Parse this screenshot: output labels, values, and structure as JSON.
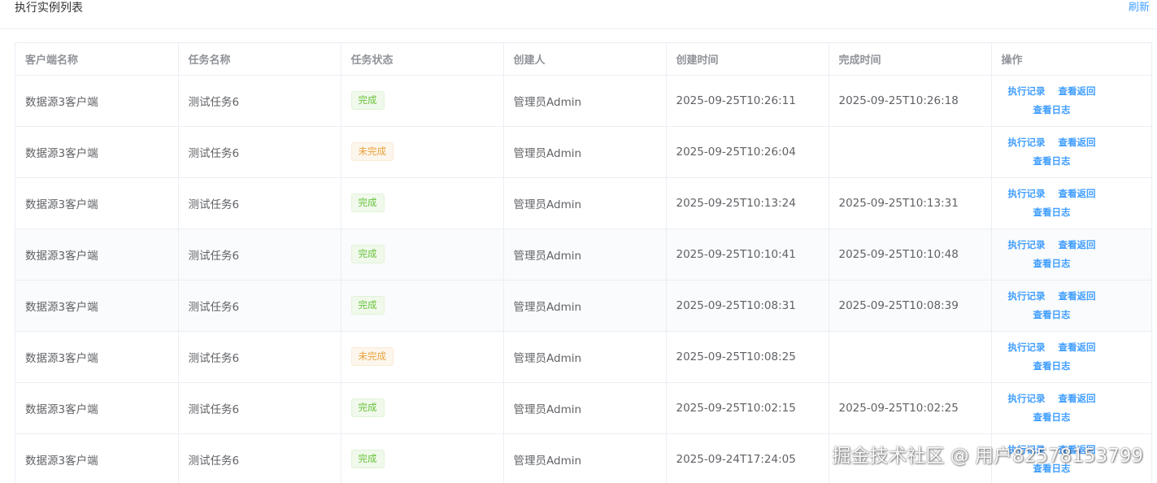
{
  "header": {
    "title": "执行实例列表",
    "refresh_label": "刷新"
  },
  "table": {
    "columns": [
      "客户端名称",
      "任务名称",
      "任务状态",
      "创建人",
      "创建时间",
      "完成时间",
      "操作"
    ],
    "actions": {
      "record": "执行记录",
      "view_return": "查看返回",
      "view_log": "查看日志"
    },
    "rows": [
      {
        "client": "数据源3客户端",
        "task": "测试任务6",
        "status": "完成",
        "status_type": "success",
        "creator": "管理员Admin",
        "created": "2025-09-25T10:26:11",
        "finished": "2025-09-25T10:26:18"
      },
      {
        "client": "数据源3客户端",
        "task": "测试任务6",
        "status": "未完成",
        "status_type": "warning",
        "creator": "管理员Admin",
        "created": "2025-09-25T10:26:04",
        "finished": ""
      },
      {
        "client": "数据源3客户端",
        "task": "测试任务6",
        "status": "完成",
        "status_type": "success",
        "creator": "管理员Admin",
        "created": "2025-09-25T10:13:24",
        "finished": "2025-09-25T10:13:31"
      },
      {
        "client": "数据源3客户端",
        "task": "测试任务6",
        "status": "完成",
        "status_type": "success",
        "creator": "管理员Admin",
        "created": "2025-09-25T10:10:41",
        "finished": "2025-09-25T10:10:48"
      },
      {
        "client": "数据源3客户端",
        "task": "测试任务6",
        "status": "完成",
        "status_type": "success",
        "creator": "管理员Admin",
        "created": "2025-09-25T10:08:31",
        "finished": "2025-09-25T10:08:39"
      },
      {
        "client": "数据源3客户端",
        "task": "测试任务6",
        "status": "未完成",
        "status_type": "warning",
        "creator": "管理员Admin",
        "created": "2025-09-25T10:08:25",
        "finished": ""
      },
      {
        "client": "数据源3客户端",
        "task": "测试任务6",
        "status": "完成",
        "status_type": "success",
        "creator": "管理员Admin",
        "created": "2025-09-25T10:02:15",
        "finished": "2025-09-25T10:02:25"
      },
      {
        "client": "数据源3客户端",
        "task": "测试任务6",
        "status": "完成",
        "status_type": "success",
        "creator": "管理员Admin",
        "created": "2025-09-24T17:24:05",
        "finished": ""
      }
    ]
  },
  "watermark": "掘金技术社区 @ 用户8257815379​9",
  "colors": {
    "link": "#409eff",
    "success": "#67c23a",
    "warning": "#e6a23c",
    "header_text": "#909399",
    "body_text": "#606266",
    "border": "#ebeef5"
  }
}
